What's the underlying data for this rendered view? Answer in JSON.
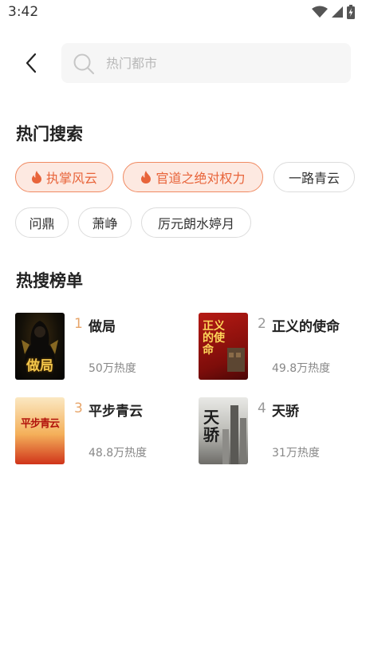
{
  "status": {
    "time": "3:42"
  },
  "search": {
    "placeholder": "热门都市",
    "value": ""
  },
  "hot_search": {
    "title": "热门搜索",
    "tags": [
      {
        "label": "执掌风云",
        "hot": true
      },
      {
        "label": "官道之绝对权力",
        "hot": true
      },
      {
        "label": "一路青云",
        "hot": false
      },
      {
        "label": "问鼎",
        "hot": false
      },
      {
        "label": "萧峥",
        "hot": false
      },
      {
        "label": "厉元朗水婷月",
        "hot": false
      }
    ]
  },
  "ranking": {
    "title": "热搜榜单",
    "items": [
      {
        "rank": "1",
        "name": "做局",
        "heat": "50万热度",
        "cover_text": "做局"
      },
      {
        "rank": "2",
        "name": "正义的使命",
        "heat": "49.8万热度",
        "cover_text": "正义的使命"
      },
      {
        "rank": "3",
        "name": "平步青云",
        "heat": "48.8万热度",
        "cover_text": "平步青云"
      },
      {
        "rank": "4",
        "name": "天骄",
        "heat": "31万热度",
        "cover_text": "天骄"
      }
    ]
  },
  "colors": {
    "accent": "#e8643a",
    "tag_hot_bg": "#fde9e1",
    "rank_gold": "#e7a56a"
  },
  "icons": {
    "back": "chevron-left-icon",
    "search": "search-icon",
    "fire": "fire-icon"
  }
}
